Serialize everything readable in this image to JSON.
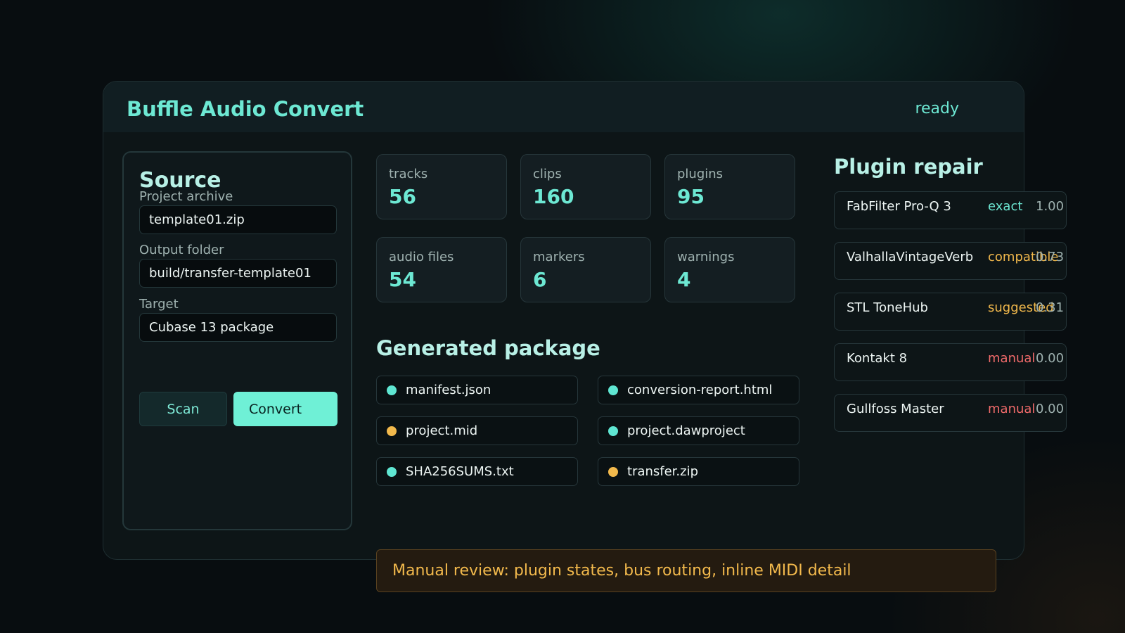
{
  "app": {
    "title": "Buffle Audio Convert",
    "status": "ready"
  },
  "source": {
    "title": "Source",
    "archive_label": "Project archive",
    "archive_value": "template01.zip",
    "output_label": "Output folder",
    "output_value": "build/transfer-template01",
    "target_label": "Target",
    "target_value": "Cubase 13 package",
    "scan_label": "Scan",
    "convert_label": "Convert"
  },
  "stats": [
    {
      "label": "tracks",
      "value": "56"
    },
    {
      "label": "clips",
      "value": "160"
    },
    {
      "label": "plugins",
      "value": "95"
    },
    {
      "label": "audio files",
      "value": "54"
    },
    {
      "label": "markers",
      "value": "6"
    },
    {
      "label": "warnings",
      "value": "4"
    }
  ],
  "package": {
    "title": "Generated package",
    "files": [
      {
        "name": "manifest.json",
        "status": "ok"
      },
      {
        "name": "conversion-report.html",
        "status": "ok"
      },
      {
        "name": "project.mid",
        "status": "warning"
      },
      {
        "name": "project.dawproject",
        "status": "ok"
      },
      {
        "name": "SHA256SUMS.txt",
        "status": "ok"
      },
      {
        "name": "transfer.zip",
        "status": "warning"
      }
    ]
  },
  "plugins": {
    "title": "Plugin repair",
    "rows": [
      {
        "name": "FabFilter Pro-Q 3",
        "match": "exact",
        "score": "1.00"
      },
      {
        "name": "ValhallaVintageVerb",
        "match": "compatible",
        "score": "0.73"
      },
      {
        "name": "STL ToneHub",
        "match": "suggested",
        "score": "0.31"
      },
      {
        "name": "Kontakt 8",
        "match": "manual",
        "score": "0.00"
      },
      {
        "name": "Gullfoss Master",
        "match": "manual",
        "score": "0.00"
      }
    ]
  },
  "review": {
    "message": "Manual review: plugin states, bus routing, inline MIDI detail"
  },
  "colors": {
    "accent": "#6de8d3",
    "ok": "#5fe6d2",
    "warning": "#f2b94c",
    "manual": "#f06a6a",
    "exact": "#6de8d3",
    "compatible": "#f2b94c",
    "suggested": "#f2b94c"
  }
}
